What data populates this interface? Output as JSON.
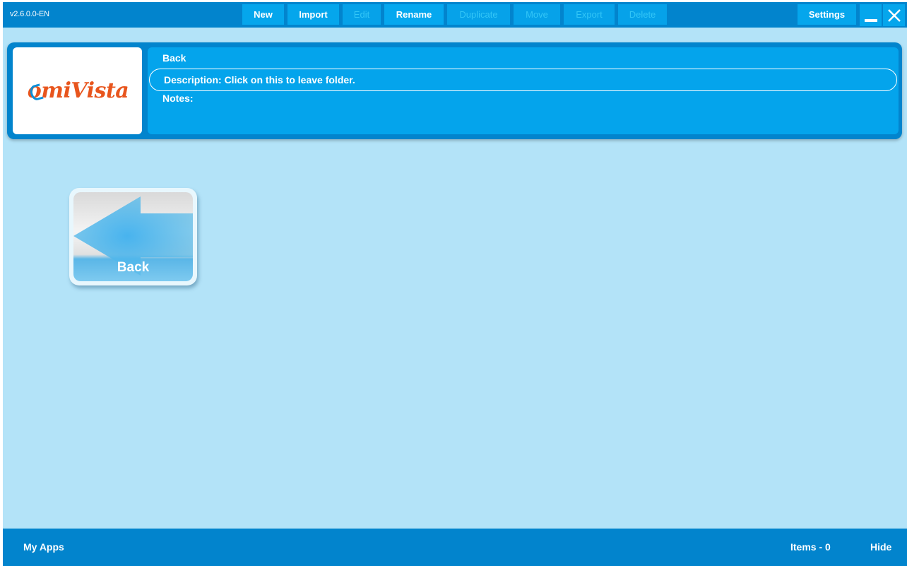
{
  "app": {
    "version": "v2.6.0.0-EN"
  },
  "toolbar": {
    "new_label": "New",
    "import_label": "Import",
    "edit_label": "Edit",
    "rename_label": "Rename",
    "duplicate_label": "Duplicate",
    "move_label": "Move",
    "export_label": "Export",
    "delete_label": "Delete",
    "settings_label": "Settings",
    "minimize_icon": "minimize-icon",
    "close_icon": "close-icon"
  },
  "info_panel": {
    "logo_text_prefix": "omi",
    "logo_text_suffix": "Vista",
    "title": "Back",
    "description": "Description: Click on this to leave folder.",
    "notes": "Notes:"
  },
  "tiles": [
    {
      "label": "Back",
      "icon": "back-arrow-icon"
    }
  ],
  "status_bar": {
    "section_label": "My Apps",
    "items_label": "Items - 0",
    "hide_label": "Hide"
  },
  "colors": {
    "brand_blue": "#0284cd",
    "accent_blue": "#04a4ec",
    "background": "#b3e3f8",
    "logo_orange": "#e8551d"
  }
}
